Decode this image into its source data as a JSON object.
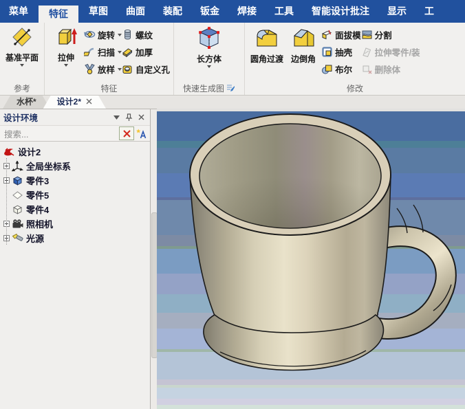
{
  "menubar": {
    "items": [
      "菜单",
      "特征",
      "草图",
      "曲面",
      "装配",
      "钣金",
      "焊接",
      "工具",
      "智能设计批注",
      "显示",
      "工"
    ]
  },
  "ribbon": {
    "reference": {
      "group_label": "参考",
      "datum_plane": "基准平面"
    },
    "features": {
      "group_label": "特征",
      "extrude": "拉伸",
      "revolve": "旋转",
      "sweep": "扫描",
      "loft": "放样",
      "thread": "螺纹",
      "thicken": "加厚",
      "custom_hole": "自定义孔"
    },
    "quick": {
      "group_label": "快速生成图",
      "box": "长方体"
    },
    "modify": {
      "group_label": "修改",
      "fillet": "圆角过渡",
      "chamfer": "边倒角",
      "face_draft": "面拔模",
      "shell": "抽壳",
      "boolean": "布尔",
      "split": "分割",
      "stretch_part": "拉伸零件/装",
      "delete_body": "删除体"
    }
  },
  "tabs": {
    "items": [
      "水杯*",
      "设计2*"
    ]
  },
  "panel": {
    "title": "设计环境",
    "search_placeholder": "搜索...",
    "tree": [
      "设计2",
      "全局坐标系",
      "零件3",
      "零件5",
      "零件4",
      "照相机",
      "光源"
    ]
  },
  "colors": {
    "accent_blue": "#21519e",
    "ribbon_bg": "#f1f0ee",
    "mug_tan": "#d9cfb8",
    "viewport_top_blue": "#4a6da0",
    "alert_red": "#cc2222"
  }
}
